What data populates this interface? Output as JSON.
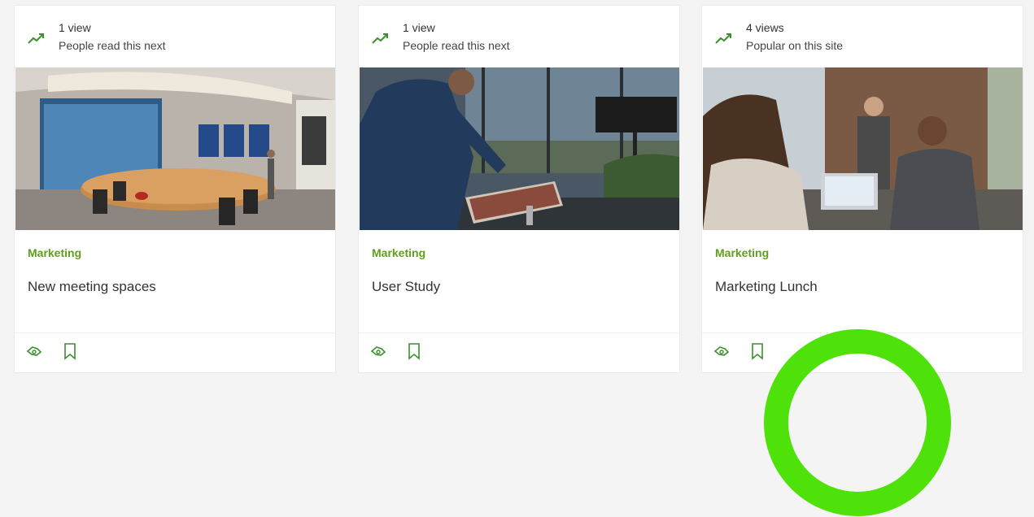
{
  "cards": [
    {
      "views": "1 view",
      "reason": "People read this next",
      "trend_icon": "trending-up-icon",
      "image": "conference-room-photo",
      "category": "Marketing",
      "title": "New meeting spaces",
      "actions": [
        "like-icon",
        "bookmark-icon"
      ]
    },
    {
      "views": "1 view",
      "reason": "People read this next",
      "trend_icon": "trending-up-icon",
      "image": "man-using-surface-studio-photo",
      "category": "Marketing",
      "title": "User Study",
      "actions": [
        "like-icon",
        "bookmark-icon"
      ]
    },
    {
      "views": "4 views",
      "reason": "Popular on this site",
      "trend_icon": "trending-up-icon",
      "image": "business-meeting-photo",
      "category": "Marketing",
      "title": "Marketing Lunch",
      "actions": [
        "like-icon",
        "bookmark-icon"
      ]
    }
  ],
  "colors": {
    "accent": "#5f9e1e",
    "trend": "#3c8f2e",
    "overlay": "#4ee10a"
  }
}
